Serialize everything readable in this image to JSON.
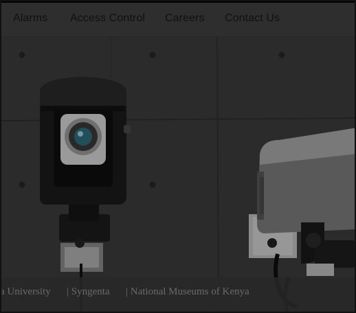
{
  "nav": {
    "items": [
      {
        "label": "Alarms"
      },
      {
        "label": "Access Control"
      },
      {
        "label": "Careers"
      },
      {
        "label": "Contact Us"
      }
    ]
  },
  "clients": {
    "items": [
      {
        "label": "a University"
      },
      {
        "label": "| Syngenta"
      },
      {
        "label": "| National Museums of Kenya"
      }
    ]
  }
}
